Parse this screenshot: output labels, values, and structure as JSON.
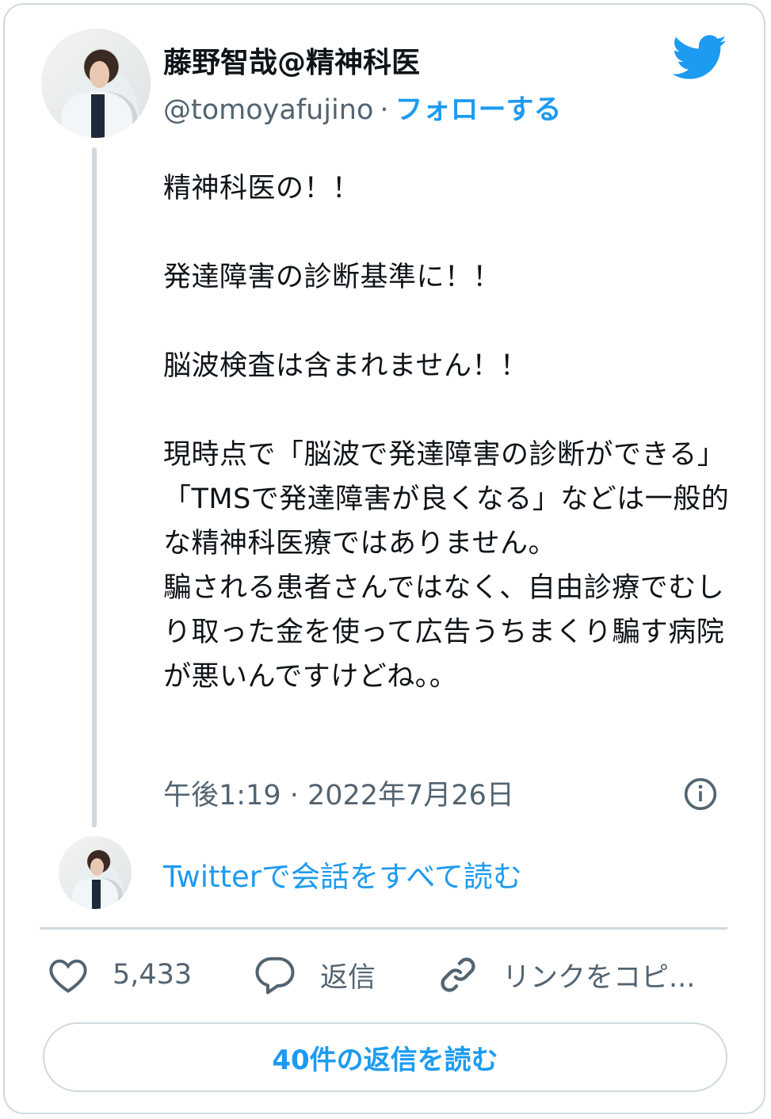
{
  "author": {
    "name": "藤野智哉@精神科医",
    "handle": "@tomoyafujino",
    "separator": "·",
    "follow_label": "フォローする"
  },
  "tweet": {
    "text": "精神科医の！！\n\n発達障害の診断基準に！！\n\n脳波検査は含まれません！！\n\n現時点で「脳波で発達障害の診断ができる」「TMSで発達障害が良くなる」などは一般的な精神科医療ではありません。\n騙される患者さんではなく、自由診療でむしり取った金を使って広告うちまくり騙す病院が悪いんですけどね。。",
    "timestamp": "午後1:19 · 2022年7月26日"
  },
  "conversation": {
    "label": "Twitterで会話をすべて読む"
  },
  "actions": {
    "like_count": "5,433",
    "reply_label": "返信",
    "copy_label": "リンクをコピ..."
  },
  "replies_button": {
    "label": "40件の返信を読む"
  },
  "colors": {
    "accent": "#1d9bf0",
    "muted": "#536471",
    "border": "#cfd9de"
  },
  "icons": [
    "twitter-bird-icon",
    "info-icon",
    "heart-icon",
    "reply-icon",
    "link-icon"
  ]
}
